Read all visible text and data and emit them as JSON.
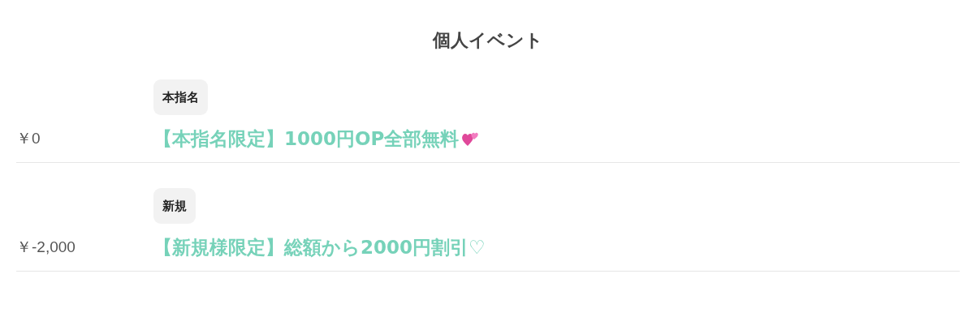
{
  "title": "個人イベント",
  "events": [
    {
      "price": "￥0",
      "tag": "本指名",
      "name": "【本指名限定】1000円OP全部無料",
      "hearts_icon": true
    },
    {
      "price": "￥-2,000",
      "tag": "新規",
      "name": "【新規様限定】総額から2000円割引♡",
      "hearts_icon": false
    }
  ]
}
